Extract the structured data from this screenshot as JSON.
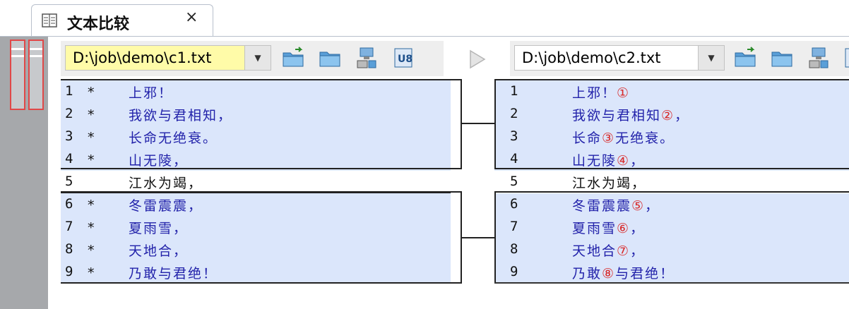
{
  "tab": {
    "title": "文本比较",
    "close": "×",
    "icon": "document-compare-icon"
  },
  "left": {
    "file": "D:\\job\\demo\\c1.txt",
    "combo_arrow": "▼",
    "lines": [
      {
        "num": "1",
        "mark": "*",
        "text": "上邪！"
      },
      {
        "num": "2",
        "mark": "*",
        "text": "我欲与君相知，"
      },
      {
        "num": "3",
        "mark": "*",
        "text": "长命无绝衰。"
      },
      {
        "num": "4",
        "mark": "*",
        "text": "山无陵，"
      },
      {
        "num": "5",
        "mark": "",
        "text": "江水为竭，"
      },
      {
        "num": "6",
        "mark": "*",
        "text": "冬雷震震，"
      },
      {
        "num": "7",
        "mark": "*",
        "text": "夏雨雪，"
      },
      {
        "num": "8",
        "mark": "*",
        "text": "天地合，"
      },
      {
        "num": "9",
        "mark": "*",
        "text": "乃敢与君绝！"
      }
    ]
  },
  "right": {
    "file": "D:\\job\\demo\\c2.txt",
    "combo_arrow": "▼",
    "lines": [
      {
        "num": "1",
        "a": "上邪！",
        "ins": "①",
        "b": ""
      },
      {
        "num": "2",
        "a": "我欲与君相知",
        "ins": "②",
        "b": "，"
      },
      {
        "num": "3",
        "a": "长命",
        "ins": "③",
        "b": "无绝衰。"
      },
      {
        "num": "4",
        "a": "山无陵",
        "ins": "④",
        "b": "，"
      },
      {
        "num": "5",
        "a": "江水为竭，",
        "ins": "",
        "b": ""
      },
      {
        "num": "6",
        "a": "冬雷震震",
        "ins": "⑤",
        "b": "，"
      },
      {
        "num": "7",
        "a": "夏雨雪",
        "ins": "⑥",
        "b": "，"
      },
      {
        "num": "8",
        "a": "天地合",
        "ins": "⑦",
        "b": "，"
      },
      {
        "num": "9",
        "a": "乃敢",
        "ins": "⑧",
        "b": "与君绝！"
      }
    ]
  },
  "toolbar_icons": [
    "open-folder-icon",
    "folder-icon",
    "network-save-icon",
    "encoding-icon"
  ],
  "colors": {
    "diff_background": "#dbe6fb",
    "diff_text": "#2222aa",
    "inserted_text": "#d92a2a",
    "active_file_background": "#fffba8"
  }
}
